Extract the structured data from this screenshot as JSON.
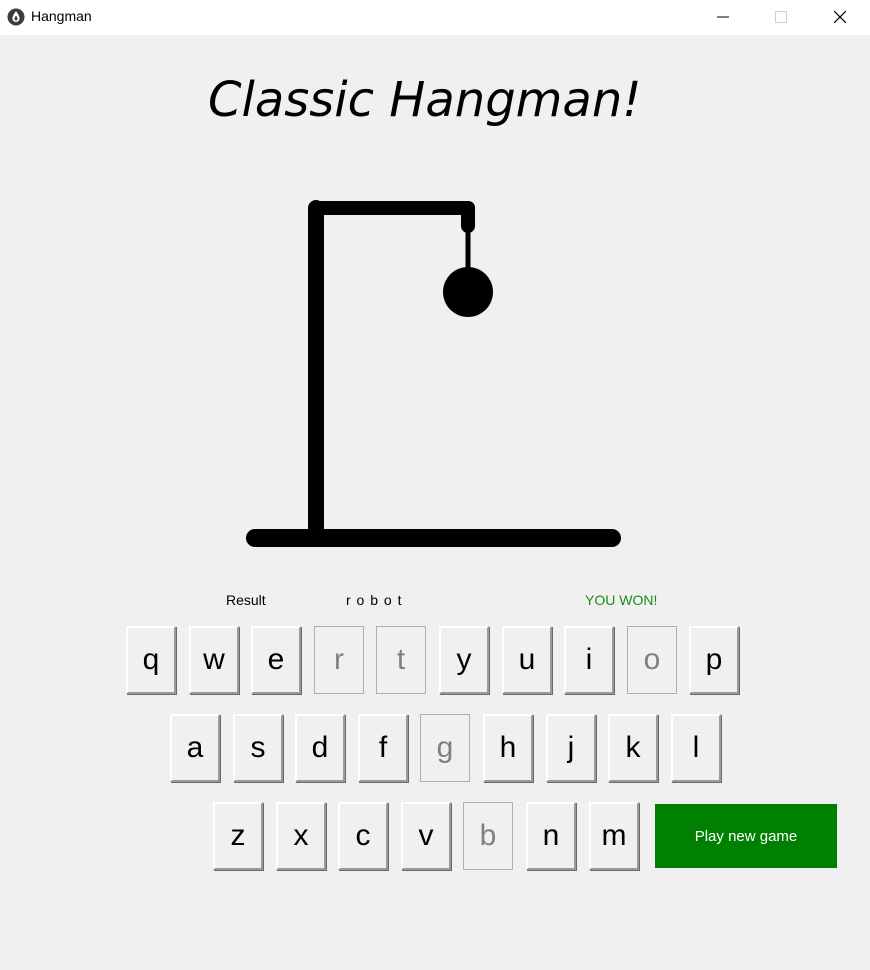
{
  "window": {
    "title": "Hangman"
  },
  "heading": "Classic Hangman!",
  "status": {
    "result_label": "Result",
    "word": "r o b o t",
    "message": "YOU WON!",
    "message_color": "#1a8c1a"
  },
  "keyboard": {
    "row1": [
      {
        "letter": "q",
        "used": false
      },
      {
        "letter": "w",
        "used": false
      },
      {
        "letter": "e",
        "used": false
      },
      {
        "letter": "r",
        "used": true
      },
      {
        "letter": "t",
        "used": true
      },
      {
        "letter": "y",
        "used": false
      },
      {
        "letter": "u",
        "used": false
      },
      {
        "letter": "i",
        "used": false
      },
      {
        "letter": "o",
        "used": true
      },
      {
        "letter": "p",
        "used": false
      }
    ],
    "row2": [
      {
        "letter": "a",
        "used": false
      },
      {
        "letter": "s",
        "used": false
      },
      {
        "letter": "d",
        "used": false
      },
      {
        "letter": "f",
        "used": false
      },
      {
        "letter": "g",
        "used": true
      },
      {
        "letter": "h",
        "used": false
      },
      {
        "letter": "j",
        "used": false
      },
      {
        "letter": "k",
        "used": false
      },
      {
        "letter": "l",
        "used": false
      }
    ],
    "row3": [
      {
        "letter": "z",
        "used": false
      },
      {
        "letter": "x",
        "used": false
      },
      {
        "letter": "c",
        "used": false
      },
      {
        "letter": "v",
        "used": false
      },
      {
        "letter": "b",
        "used": true
      },
      {
        "letter": "n",
        "used": false
      },
      {
        "letter": "m",
        "used": false
      }
    ]
  },
  "play_button": {
    "label": "Play new game",
    "color": "#008000"
  },
  "icons": {
    "app": "hangman-app-icon",
    "minimize": "minimize-icon",
    "maximize": "maximize-icon",
    "close": "close-icon"
  }
}
